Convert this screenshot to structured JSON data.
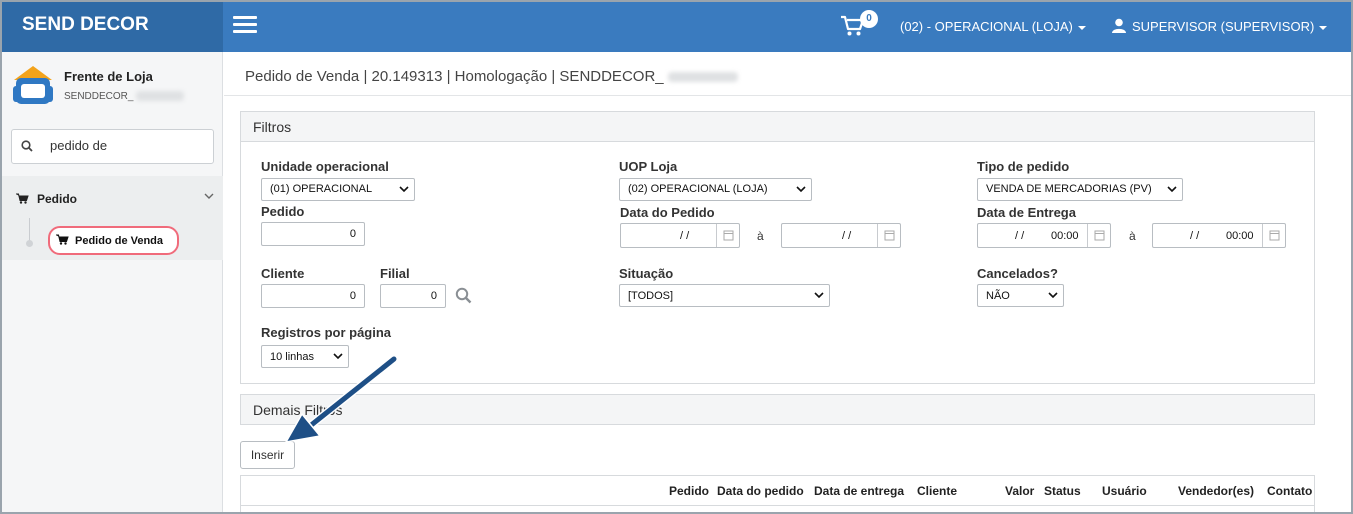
{
  "app": {
    "brand": "SEND DECOR",
    "cart_count": "0",
    "uop_menu": "(02) - OPERACIONAL (LOJA)",
    "user_menu": "SUPERVISOR (SUPERVISOR)"
  },
  "sidebar": {
    "store_title": "Frente de Loja",
    "store_sub": "SENDDECOR_",
    "search_value": "pedido de",
    "group_label": "Pedido",
    "active_item": "Pedido de Venda"
  },
  "page": {
    "title": "Pedido de Venda | 20.149313 | Homologação | SENDDECOR_"
  },
  "filters": {
    "panel_title": "Filtros",
    "unidade_label": "Unidade operacional",
    "unidade_value": "(01) OPERACIONAL",
    "uop_label": "UOP Loja",
    "uop_value": "(02) OPERACIONAL (LOJA)",
    "tipo_label": "Tipo de pedido",
    "tipo_value": "VENDA DE MERCADORIAS (PV)",
    "pedido_label": "Pedido",
    "pedido_value": "0",
    "data_pedido_label": "Data do Pedido",
    "data_pedido_from": "/ /",
    "data_pedido_to": "/ /",
    "data_entrega_label": "Data de Entrega",
    "data_entrega_from_date": "/ /",
    "data_entrega_from_time": "00:00",
    "data_entrega_to_date": "/ /",
    "data_entrega_to_time": "00:00",
    "separator": "à",
    "cliente_label": "Cliente",
    "cliente_value": "0",
    "filial_label": "Filial",
    "filial_value": "0",
    "situacao_label": "Situação",
    "situacao_value": "[TODOS]",
    "cancelados_label": "Cancelados?",
    "cancelados_value": "NÃO",
    "registros_label": "Registros por página",
    "registros_value": "10 linhas"
  },
  "demais_filtros": "Demais Filtros",
  "insert_button": "Inserir",
  "table": {
    "columns": [
      "Pedido",
      "Data do pedido",
      "Data de entrega",
      "Cliente",
      "Valor",
      "Status",
      "Usuário",
      "Vendedor(es)",
      "Contato"
    ]
  },
  "colors": {
    "topbar": "#3a7bbf",
    "brand_bg": "#2f6aa6",
    "active_outline": "#f06b7b",
    "arrow": "#1e4f86"
  },
  "icons": [
    "hamburger-icon",
    "cart-icon",
    "caret-icon",
    "user-icon",
    "store-logo-icon",
    "search-icon",
    "chevron-down-icon",
    "calendar-icon",
    "arrow-annotation"
  ]
}
